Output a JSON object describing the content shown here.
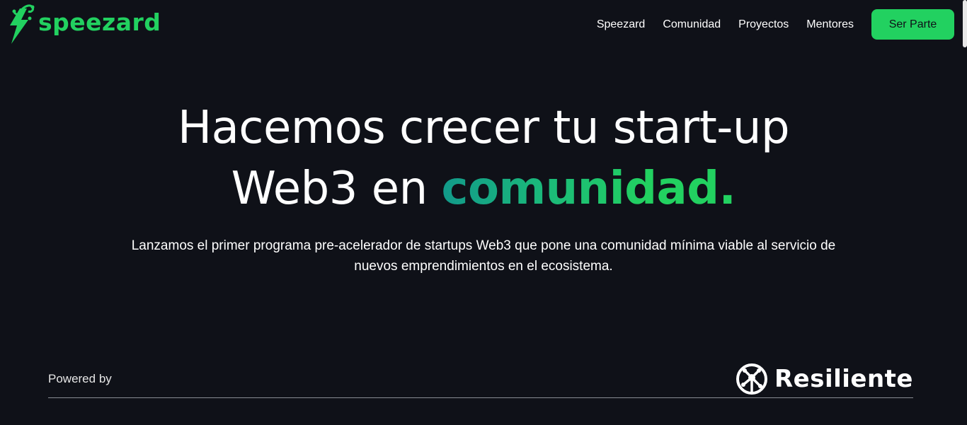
{
  "header": {
    "logo_text": "speezard",
    "logo_icon": "lizard-lightning-icon",
    "nav": [
      {
        "label": "Speezard"
      },
      {
        "label": "Comunidad"
      },
      {
        "label": "Proyectos"
      },
      {
        "label": "Mentores"
      }
    ],
    "cta_label": "Ser Parte"
  },
  "hero": {
    "title_line1": "Hacemos crecer tu start-up",
    "title_line2_prefix": "Web3 en ",
    "title_line2_accent": "comunidad.",
    "subtitle": "Lanzamos el primer programa pre-acelerador de startups Web3 que pone una comunidad mínima viable al servicio de nuevos emprendimientos en el ecosistema."
  },
  "footer": {
    "powered_by": "Powered by",
    "partner_name": "Resiliente",
    "partner_icon": "resiliente-gecko-icon"
  },
  "colors": {
    "background": "#0f1118",
    "accent": "#22d160",
    "accent_gradient_start": "#129a8a"
  }
}
